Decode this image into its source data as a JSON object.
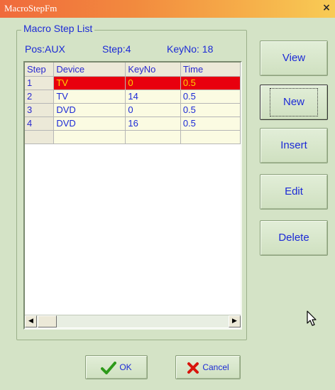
{
  "window": {
    "title": "MacroStepFm",
    "close_glyph": "×"
  },
  "group": {
    "caption": "Macro Step List"
  },
  "info": {
    "pos": "Pos:AUX",
    "step": "Step:4",
    "keyno": "KeyNo: 18"
  },
  "grid": {
    "columns": [
      "Step",
      "Device",
      "KeyNo",
      "Time"
    ],
    "rows": [
      {
        "step": "1",
        "device": "TV",
        "keyno": "0",
        "time": "0.5",
        "selected": true
      },
      {
        "step": "2",
        "device": "TV",
        "keyno": "14",
        "time": "0.5",
        "selected": false
      },
      {
        "step": "3",
        "device": "DVD",
        "keyno": "0",
        "time": "0.5",
        "selected": false
      },
      {
        "step": "4",
        "device": "DVD",
        "keyno": "16",
        "time": "0.5",
        "selected": false
      },
      {
        "step": "",
        "device": "",
        "keyno": "",
        "time": "",
        "selected": false
      }
    ]
  },
  "scrollbar": {
    "left_glyph": "◀",
    "right_glyph": "▶"
  },
  "buttons": {
    "view": "View",
    "new": "New",
    "insert": "Insert",
    "edit": "Edit",
    "delete": "Delete",
    "ok": "OK",
    "cancel": "Cancel"
  },
  "icons": {
    "ok": "checkmark-icon",
    "cancel": "x-icon",
    "cursor": "mouse-pointer-icon"
  },
  "colors": {
    "text_blue": "#1c2ad6",
    "selected_row_bg": "#e8000e",
    "selected_row_text": "#ffd400",
    "window_bg": "#d4e3c6"
  }
}
